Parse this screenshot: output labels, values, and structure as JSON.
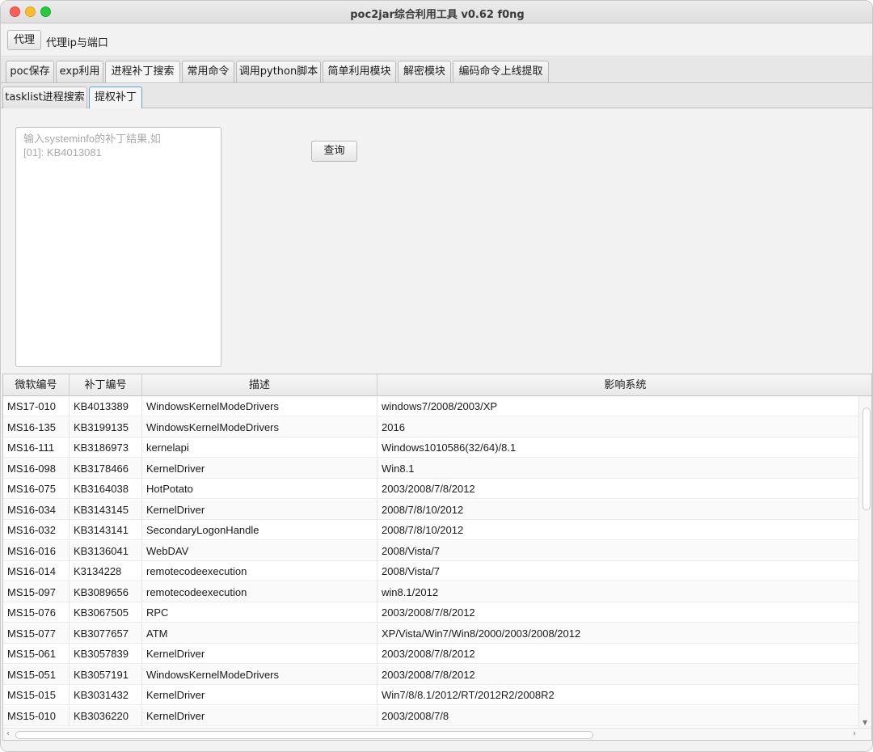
{
  "window": {
    "title": "poc2jar综合利用工具 v0.62  f0ng"
  },
  "proxy": {
    "button_label": "代理",
    "label": "代理ip与端口"
  },
  "tabs": [
    {
      "label": "poc保存"
    },
    {
      "label": "exp利用"
    },
    {
      "label": "进程补丁搜索",
      "active": true
    },
    {
      "label": "常用命令"
    },
    {
      "label": "调用python脚本"
    },
    {
      "label": "简单利用模块"
    },
    {
      "label": "解密模块"
    },
    {
      "label": "编码命令上线提取"
    }
  ],
  "subtabs": [
    {
      "label": "tasklist进程搜索"
    },
    {
      "label": "提权补丁",
      "active": true
    }
  ],
  "patch_input": {
    "placeholder": "输入systeminfo的补丁结果,如\n[01]: KB4013081",
    "value": ""
  },
  "query_button": {
    "label": "查询"
  },
  "table": {
    "headers": [
      "微软编号",
      "补丁编号",
      "描述",
      "影响系统"
    ],
    "rows": [
      [
        "MS17-010",
        "KB4013389",
        "WindowsKernelModeDrivers",
        "windows7/2008/2003/XP"
      ],
      [
        "MS16-135",
        "KB3199135",
        "WindowsKernelModeDrivers",
        "2016"
      ],
      [
        "MS16-111",
        "KB3186973",
        "kernelapi",
        "Windows1010586(32/64)/8.1"
      ],
      [
        "MS16-098",
        "KB3178466",
        "KernelDriver",
        "Win8.1"
      ],
      [
        "MS16-075",
        "KB3164038",
        "HotPotato",
        "2003/2008/7/8/2012"
      ],
      [
        "MS16-034",
        "KB3143145",
        "KernelDriver",
        "2008/7/8/10/2012"
      ],
      [
        "MS16-032",
        "KB3143141",
        "SecondaryLogonHandle",
        "2008/7/8/10/2012"
      ],
      [
        "MS16-016",
        "KB3136041",
        "WebDAV",
        "2008/Vista/7"
      ],
      [
        "MS16-014",
        "K3134228",
        "remotecodeexecution",
        "2008/Vista/7"
      ],
      [
        "MS15-097",
        "KB3089656",
        "remotecodeexecution",
        "win8.1/2012"
      ],
      [
        "MS15-076",
        "KB3067505",
        "RPC",
        "2003/2008/7/8/2012"
      ],
      [
        "MS15-077",
        "KB3077657",
        "ATM",
        "XP/Vista/Win7/Win8/2000/2003/2008/2012"
      ],
      [
        "MS15-061",
        "KB3057839",
        "KernelDriver",
        "2003/2008/7/8/2012"
      ],
      [
        "MS15-051",
        "KB3057191",
        "WindowsKernelModeDrivers",
        "2003/2008/7/8/2012"
      ],
      [
        "MS15-015",
        "KB3031432",
        "KernelDriver",
        "Win7/8/8.1/2012/RT/2012R2/2008R2"
      ],
      [
        "MS15-010",
        "KB3036220",
        "KernelDriver",
        "2003/2008/7/8"
      ]
    ]
  },
  "colors": {
    "active_subtab_border": "#5fa3d8",
    "close": "#fe5f57",
    "minimize": "#febc2e",
    "maximize": "#28c840"
  }
}
